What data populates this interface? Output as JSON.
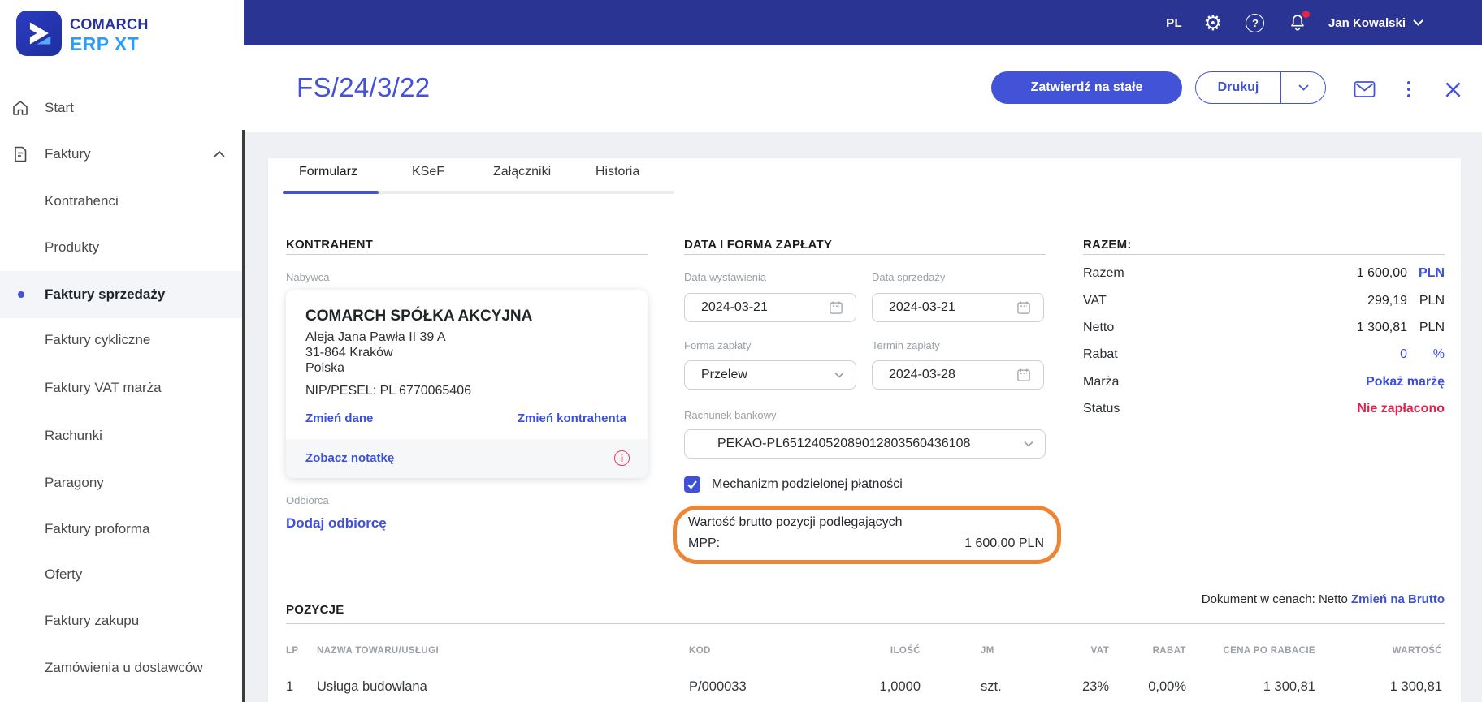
{
  "colors": {
    "topbar_blue": "#2a3492",
    "accent_blue": "#4353d8",
    "link_blue": "#3d50d9",
    "danger_red": "#e5204c",
    "highlight_orange": "#ee8534",
    "notification_red": "#e5244c",
    "background_gray": "#eef0f4"
  },
  "logo": {
    "line1": "COMARCH",
    "line2": "ERP XT"
  },
  "topbar": {
    "language": "PL",
    "user_name": "Jan Kowalski"
  },
  "sidebar": {
    "items": [
      {
        "label": "Start"
      },
      {
        "label": "Faktury"
      },
      {
        "label": "Kontrahenci"
      },
      {
        "label": "Produkty"
      },
      {
        "label": "Faktury sprzedaży"
      },
      {
        "label": "Faktury cykliczne"
      },
      {
        "label": "Faktury VAT marża"
      },
      {
        "label": "Rachunki"
      },
      {
        "label": "Paragony"
      },
      {
        "label": "Faktury proforma"
      },
      {
        "label": "Oferty"
      },
      {
        "label": "Faktury zakupu"
      },
      {
        "label": "Zamówienia u dostawców"
      }
    ]
  },
  "header": {
    "title": "FS/24/3/22",
    "approve_label": "Zatwierdź na stałe",
    "print_label": "Drukuj"
  },
  "tabs": [
    {
      "label": "Formularz"
    },
    {
      "label": "KSeF"
    },
    {
      "label": "Załączniki"
    },
    {
      "label": "Historia"
    }
  ],
  "kontrahent": {
    "heading": "KONTRAHENT",
    "buyer_label": "Nabywca",
    "name": "COMARCH SPÓŁKA AKCYJNA",
    "address_line1": "Aleja Jana Pawła II 39 A",
    "address_line2": "31-864 Kraków",
    "address_line3": "Polska",
    "nip": "NIP/PESEL: PL 6770065406",
    "change_data_label": "Zmień dane",
    "change_contractor_label": "Zmień kontrahenta",
    "see_note_label": "Zobacz notatkę",
    "recipient_label": "Odbiorca",
    "add_recipient_label": "Dodaj odbiorcę"
  },
  "payment": {
    "heading": "DATA I FORMA ZAPŁATY",
    "issue_date_label": "Data wystawienia",
    "issue_date": "2024-03-21",
    "sale_date_label": "Data sprzedaży",
    "sale_date": "2024-03-21",
    "payment_form_label": "Forma zapłaty",
    "payment_form": "Przelew",
    "due_date_label": "Termin zapłaty",
    "due_date": "2024-03-28",
    "bank_account_label": "Rachunek bankowy",
    "bank_account": "PEKAO-PL65124052089012803560436108",
    "split_payment_label": "Mechanizm podzielonej płatności",
    "mpp_label_line1": "Wartość brutto pozycji podlegających",
    "mpp_label_line2": "MPP:",
    "mpp_value": "1 600,00 PLN"
  },
  "totals": {
    "heading": "RAZEM:",
    "rows": [
      {
        "label": "Razem",
        "value": "1 600,00",
        "unit": "PLN"
      },
      {
        "label": "VAT",
        "value": "299,19",
        "unit": "PLN"
      },
      {
        "label": "Netto",
        "value": "1 300,81",
        "unit": "PLN"
      },
      {
        "label": "Rabat",
        "value": "0",
        "unit": "%"
      },
      {
        "label": "Marża",
        "value": "Pokaż marżę"
      },
      {
        "label": "Status",
        "value": "Nie zapłacono"
      }
    ]
  },
  "positions": {
    "heading": "POZYCJE",
    "doc_prices_label": "Dokument w cenach: Netto",
    "change_prices_label": "Zmień na Brutto",
    "columns": [
      "LP",
      "NAZWA TOWARU/USŁUGI",
      "KOD",
      "ILOŚĆ",
      "JM",
      "VAT",
      "RABAT",
      "CENA PO RABACIE",
      "WARTOŚĆ"
    ],
    "rows": [
      [
        "1",
        "Usługa budowlana",
        "P/000033",
        "1,0000",
        "szt.",
        "23%",
        "0,00%",
        "1 300,81",
        "1 300,81"
      ]
    ]
  }
}
